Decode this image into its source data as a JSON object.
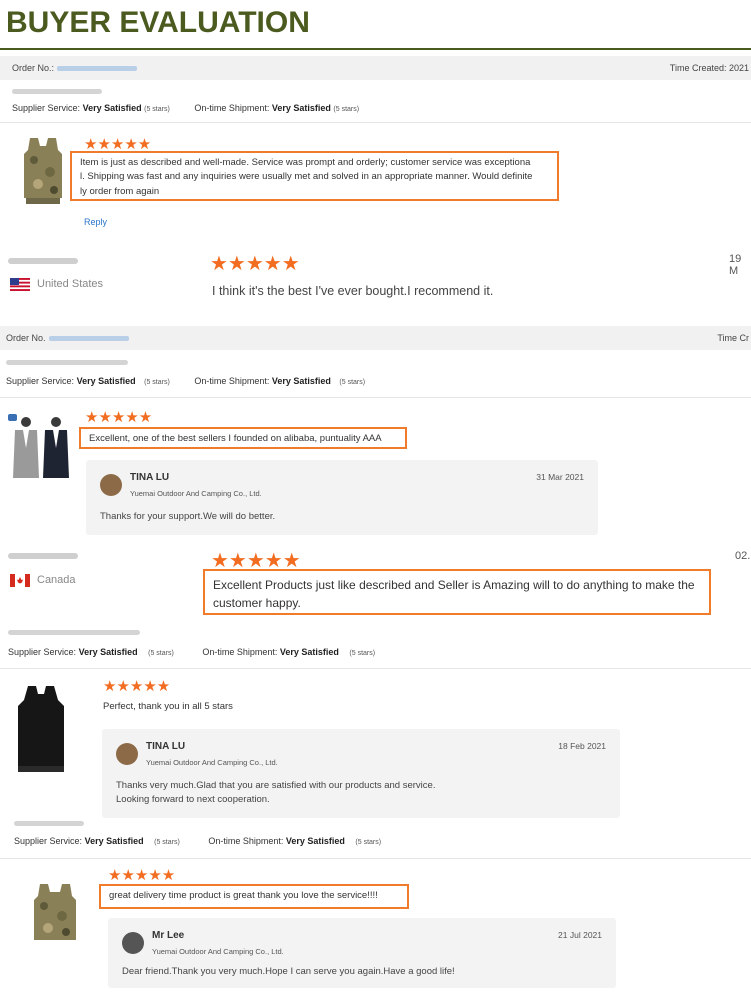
{
  "header": {
    "title": "BUYER EVALUATION"
  },
  "order1": {
    "label": "Order No.:",
    "time_label": "Time Created: 2021"
  },
  "order2": {
    "label": "Order No.",
    "time_label": "Time Cr"
  },
  "service": {
    "supplier_label": "Supplier Service:",
    "shipment_label": "On-time Shipment:",
    "value": "Very Satisfied",
    "stars_note": "(5 stars)"
  },
  "stars": "★★★★★",
  "reviews": {
    "r1": {
      "text_line1": "Item is just as described and well-made. Service was prompt and orderly; customer service was exceptiona",
      "text_line2": "l. Shipping was fast and any inquiries were usually met and solved in an appropriate manner. Would definite",
      "text_line3": "ly order from again",
      "reply_link": "Reply"
    },
    "r2": {
      "country": "United States",
      "date": "19 M",
      "text": "I think it's the best I've ever bought.I recommend it."
    },
    "r3": {
      "text": "Excellent, one of the best sellers I founded on alibaba, puntuality AAA"
    },
    "r4": {
      "country": "Canada",
      "date": "02.",
      "text_line1": "Excellent Products just like described and Seller is Amazing will to do anything to make the",
      "text_line2": "customer happy."
    },
    "r5": {
      "text": "Perfect, thank you in all 5 stars"
    },
    "r6": {
      "text": "great delivery time product is great thank you love the service!!!!"
    }
  },
  "replies": {
    "rep1": {
      "name": "TINA LU",
      "company": "Yuemai Outdoor And Camping Co., Ltd.",
      "date": "31 Mar 2021",
      "msg": "Thanks for your support.We will do better."
    },
    "rep2": {
      "name": "TINA LU",
      "company": "Yuemai Outdoor And Camping Co., Ltd.",
      "date": "18 Feb 2021",
      "msg_line1": "Thanks very much.Glad that you are satisfied with our products and service.",
      "msg_line2": "Looking forward to next cooperation."
    },
    "rep3": {
      "name": "Mr Lee",
      "company": "Yuemai Outdoor And Camping Co., Ltd.",
      "date": "21 Jul 2021",
      "msg": "Dear friend.Thank you very much.Hope I can serve you again.Have a good life!"
    }
  },
  "colors": {
    "accent": "#4b5a1e",
    "star": "#f26d21",
    "highlight_border": "#f07b2b",
    "link": "#2b76c9"
  }
}
